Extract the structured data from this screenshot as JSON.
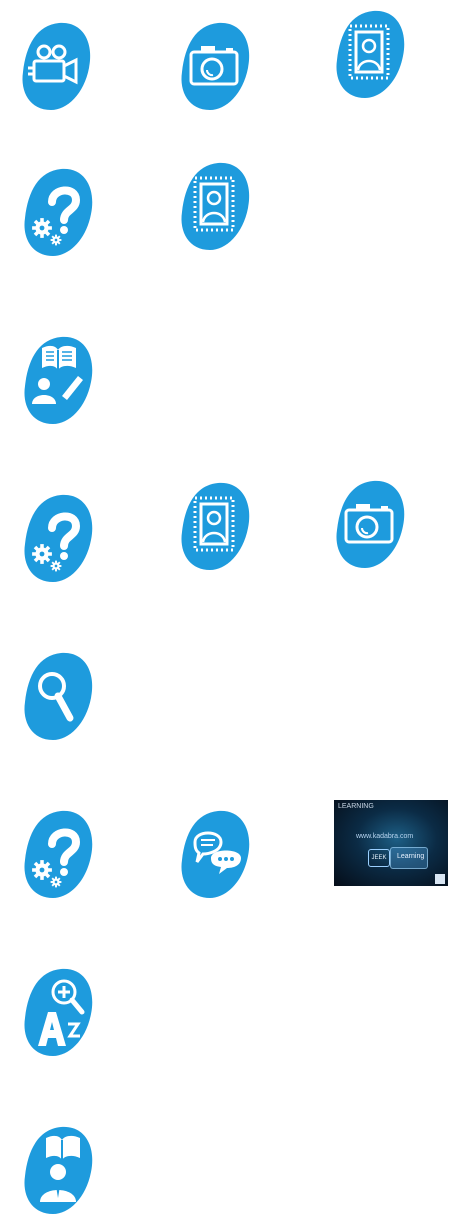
{
  "colors": {
    "icon_blue": "#1E9BDD",
    "icon_white": "#ffffff"
  },
  "rows": [
    {
      "items": [
        "video-camera-icon",
        "camera-icon",
        "portrait-stamp-icon"
      ]
    },
    {
      "items": [
        "help-settings-icon",
        "portrait-stamp-icon"
      ]
    },
    {
      "items": [
        "reader-book-pen-icon"
      ]
    },
    {
      "items": [
        "help-settings-icon",
        "portrait-stamp-icon",
        "camera-icon"
      ]
    },
    {
      "items": [
        "search-icon"
      ]
    },
    {
      "items": [
        "help-settings-icon",
        "chat-bubbles-icon",
        "video-thumbnail"
      ]
    },
    {
      "items": [
        "dictionary-az-icon"
      ]
    },
    {
      "items": [
        "reader-book-icon"
      ]
    }
  ],
  "thumbnail": {
    "top_text": "LEARNING",
    "url_text": "www.kadabra.com",
    "badge_text": "JEEK",
    "panel_text": "Learning"
  }
}
